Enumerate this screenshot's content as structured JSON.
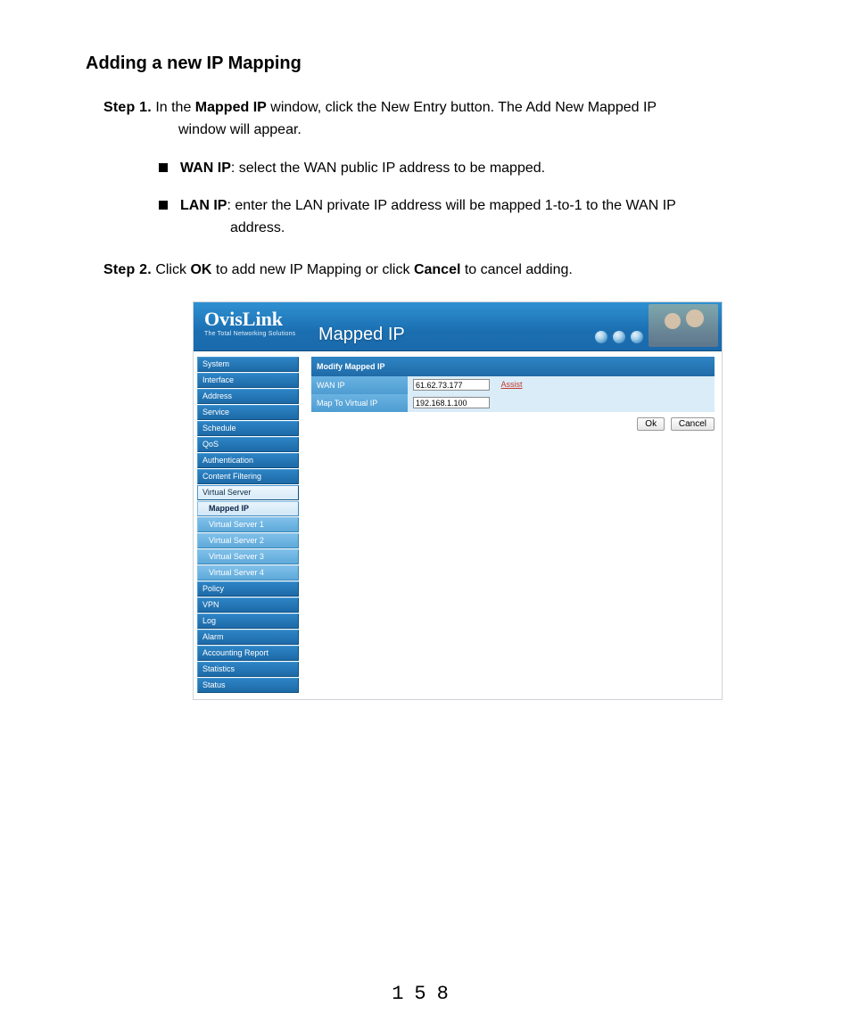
{
  "heading": "Adding a new IP Mapping",
  "step1": {
    "label": "Step 1.",
    "pre": " In the ",
    "bold1": "Mapped IP",
    "mid": " window, click the New Entry button. The Add New Mapped IP",
    "line2": "window will appear."
  },
  "bullets": {
    "wan": {
      "label": "WAN IP",
      "text": ": select the WAN public IP address to be mapped."
    },
    "lan": {
      "label": "LAN IP",
      "text": ": enter the LAN private IP address will be mapped 1-to-1 to the WAN IP",
      "text2": "address."
    }
  },
  "step2": {
    "label": "Step 2.",
    "pre": " Click ",
    "ok": "OK",
    "mid": " to add new IP Mapping or click ",
    "cancel": "Cancel",
    "post": " to cancel adding."
  },
  "app": {
    "brand": "OvisLink",
    "tagline": "The Total Networking Solutions",
    "title": "Mapped IP",
    "nav": {
      "items": [
        "System",
        "Interface",
        "Address",
        "Service",
        "Schedule",
        "QoS",
        "Authentication",
        "Content Filtering",
        "Virtual Server"
      ],
      "sub": [
        "Mapped IP",
        "Virtual Server 1",
        "Virtual Server 2",
        "Virtual Server 3",
        "Virtual Server 4"
      ],
      "items2": [
        "Policy",
        "VPN",
        "Log",
        "Alarm",
        "Accounting Report",
        "Statistics",
        "Status"
      ]
    },
    "form": {
      "header": "Modify Mapped IP",
      "wan_label": "WAN IP",
      "wan_value": "61.62.73.177",
      "assist": "Assist",
      "map_label": "Map To Virtual IP",
      "map_value": "192.168.1.100",
      "ok": "Ok",
      "cancel": "Cancel"
    }
  },
  "page_number": "158"
}
